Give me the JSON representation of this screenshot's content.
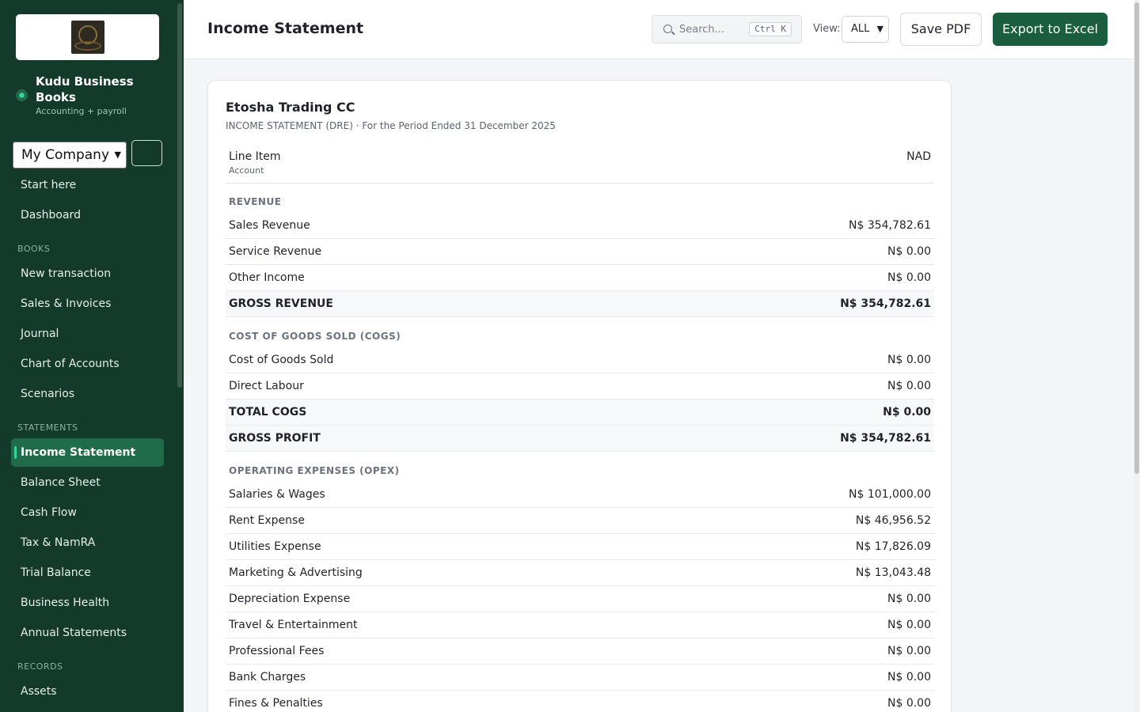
{
  "sidebar": {
    "brand_name": "Kudu Business Books",
    "brand_tagline": "Accounting + payroll",
    "company_select": "My Company",
    "top_items": [
      {
        "label": "Start here"
      },
      {
        "label": "Dashboard"
      }
    ],
    "sections": [
      {
        "title": "BOOKS",
        "items": [
          {
            "label": "New transaction"
          },
          {
            "label": "Sales & Invoices"
          },
          {
            "label": "Journal"
          },
          {
            "label": "Chart of Accounts"
          },
          {
            "label": "Scenarios"
          }
        ]
      },
      {
        "title": "STATEMENTS",
        "items": [
          {
            "label": "Income Statement",
            "active": true
          },
          {
            "label": "Balance Sheet"
          },
          {
            "label": "Cash Flow"
          },
          {
            "label": "Tax & NamRA"
          },
          {
            "label": "Trial Balance"
          },
          {
            "label": "Business Health"
          },
          {
            "label": "Annual Statements"
          }
        ]
      },
      {
        "title": "RECORDS",
        "items": [
          {
            "label": "Assets"
          }
        ]
      }
    ]
  },
  "header": {
    "title": "Income Statement",
    "search_placeholder": "Search...",
    "search_shortcut": "Ctrl K",
    "view_label": "View:",
    "view_value": "ALL",
    "save_pdf": "Save PDF",
    "export_excel": "Export to Excel"
  },
  "statement": {
    "company": "Etosha Trading CC",
    "subtitle": "INCOME STATEMENT (DRE) · For the Period Ended 31 December 2025",
    "col_item": "Line Item",
    "col_account": "Account",
    "col_currency": "NAD",
    "revenue": {
      "title": "REVENUE",
      "rows": [
        {
          "label": "Sales Revenue",
          "value": "N$ 354,782.61"
        },
        {
          "label": "Service Revenue",
          "value": "N$ 0.00"
        },
        {
          "label": "Other Income",
          "value": "N$ 0.00"
        }
      ],
      "total": {
        "label": "GROSS REVENUE",
        "value": "N$ 354,782.61"
      }
    },
    "cogs": {
      "title": "COST OF GOODS SOLD (COGS)",
      "rows": [
        {
          "label": "Cost of Goods Sold",
          "value": "N$ 0.00"
        },
        {
          "label": "Direct Labour",
          "value": "N$ 0.00"
        }
      ],
      "total": {
        "label": "TOTAL COGS",
        "value": "N$ 0.00"
      },
      "gross_profit": {
        "label": "GROSS PROFIT",
        "value": "N$ 354,782.61"
      }
    },
    "opex": {
      "title": "OPERATING EXPENSES (OPEX)",
      "rows": [
        {
          "label": "Salaries & Wages",
          "value": "N$ 101,000.00"
        },
        {
          "label": "Rent Expense",
          "value": "N$ 46,956.52"
        },
        {
          "label": "Utilities Expense",
          "value": "N$ 17,826.09"
        },
        {
          "label": "Marketing & Advertising",
          "value": "N$ 13,043.48"
        },
        {
          "label": "Depreciation Expense",
          "value": "N$ 0.00"
        },
        {
          "label": "Travel & Entertainment",
          "value": "N$ 0.00"
        },
        {
          "label": "Professional Fees",
          "value": "N$ 0.00"
        },
        {
          "label": "Bank Charges",
          "value": "N$ 0.00"
        },
        {
          "label": "Fines & Penalties",
          "value": "N$ 0.00"
        }
      ]
    }
  },
  "colors": {
    "sidebar_bg": "#133a2b",
    "accent": "#1b5e3f",
    "active_nav": "#1f6b4a",
    "status_dot": "#34d399"
  }
}
